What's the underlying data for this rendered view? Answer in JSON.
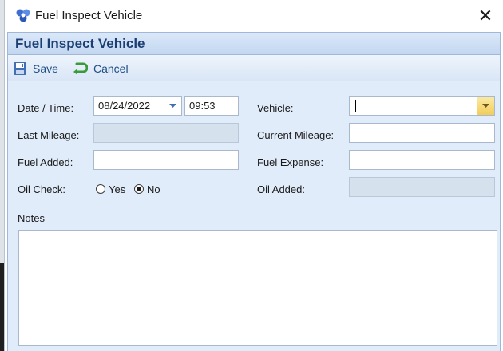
{
  "window": {
    "title": "Fuel Inspect Vehicle",
    "close_glyph": "✕"
  },
  "form": {
    "header": "Fuel Inspect Vehicle"
  },
  "toolbar": {
    "save_label": "Save",
    "cancel_label": "Cancel"
  },
  "fields": {
    "date_time_label": "Date / Time:",
    "date_value": "08/24/2022",
    "time_value": "09:53",
    "vehicle_label": "Vehicle:",
    "vehicle_value": "",
    "last_mileage_label": "Last Mileage:",
    "last_mileage_value": "",
    "current_mileage_label": "Current Mileage:",
    "current_mileage_value": "",
    "fuel_added_label": "Fuel Added:",
    "fuel_added_value": "",
    "fuel_expense_label": "Fuel Expense:",
    "fuel_expense_value": "",
    "oil_check_label": "Oil Check:",
    "oil_check_yes": "Yes",
    "oil_check_no": "No",
    "oil_check_selected": "No",
    "oil_added_label": "Oil Added:",
    "oil_added_value": "",
    "notes_label": "Notes"
  },
  "icons": {
    "app": "app-icon",
    "close": "close-icon",
    "save": "save-icon",
    "cancel": "cancel-icon",
    "dropdown": "chevron-down-icon"
  },
  "colors": {
    "header_text": "#1c3f73",
    "toolbar_text": "#1f4e84",
    "body_bg": "#e1ecfa",
    "disabled_field": "#d6e1ee",
    "vehicle_dropdown": "#f2cd5a"
  }
}
